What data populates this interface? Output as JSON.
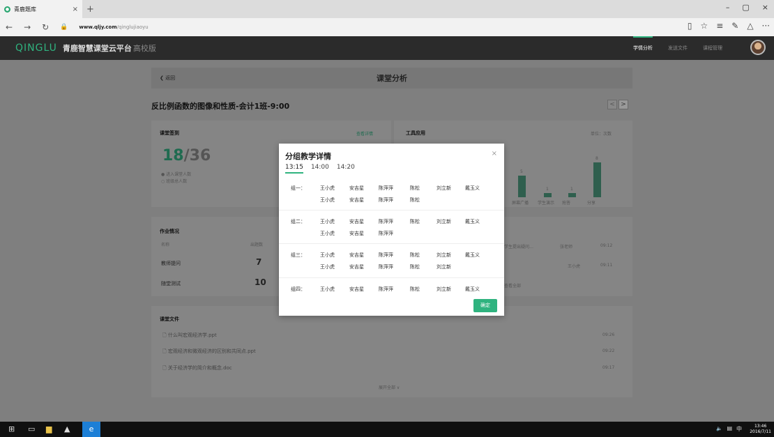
{
  "browser": {
    "tab_title": "青鹿题库",
    "tab_close": "×",
    "new_tab": "+",
    "url_domain": "www.qljy.com",
    "url_path": "/qinglujiaoyu",
    "win_min": "–",
    "win_max": "▢",
    "win_close": "×",
    "back": "←",
    "forward": "→",
    "refresh": "↻",
    "lock": "🔒",
    "reading": "▯",
    "fav": "☆",
    "hub": "≡",
    "note": "✎",
    "share": "△",
    "more": "···"
  },
  "app": {
    "logo": "QINGLU",
    "title": "青鹿智慧课堂云平台",
    "edition": "高校版",
    "nav": [
      "学情分析",
      "发送文件",
      "课程管理"
    ]
  },
  "page": {
    "back": "返回",
    "header": "课堂分析",
    "lesson": "反比例函数的图像和性质-会计1班-9:00",
    "prev": "<",
    "next": ">"
  },
  "signin": {
    "title": "课堂签到",
    "link": "查看详情",
    "count": "18",
    "total": "/36",
    "legend1": "进入课堂人数",
    "legend2": "班级总人数"
  },
  "tools": {
    "title": "工具应用",
    "unit": "单位：次数",
    "bars": [
      {
        "label": "屏幕广播",
        "value": 5
      },
      {
        "label": "学生演示",
        "value": 1
      },
      {
        "label": "抢答",
        "value": 1
      },
      {
        "label": "分享",
        "value": 8
      }
    ]
  },
  "homework": {
    "title": "作业情况",
    "col_name": "名称",
    "col_count": "出题数",
    "rows": [
      {
        "name": "教师提问",
        "count": "7"
      },
      {
        "name": "随堂测试",
        "count": "10"
      }
    ],
    "side": [
      {
        "text": "学生提出疑问…",
        "who": "张老师",
        "time": "09:12"
      },
      {
        "text": "",
        "who": "王小虎",
        "time": "09:11"
      }
    ],
    "more": "查看全部"
  },
  "files": {
    "title": "课堂文件",
    "items": [
      {
        "name": "什么叫宏观经济学.ppt",
        "time": "09:26"
      },
      {
        "name": "宏观经济和微观经济的区别和共同点.ppt",
        "time": "09:22"
      },
      {
        "name": "关于经济学的简介和概念.doc",
        "time": "09:17"
      }
    ],
    "expand": "展开全部 ∨"
  },
  "modal": {
    "title": "分组教学详情",
    "close": "×",
    "times": [
      "13:15",
      "14:00",
      "14:20"
    ],
    "groups": [
      {
        "name": "组一：",
        "rows": [
          [
            "王小虎",
            "安吉星",
            "陈萍萍",
            "陈松",
            "刘立新",
            "戴玉义"
          ],
          [
            "王小虎",
            "安吉星",
            "陈萍萍",
            "陈松"
          ]
        ]
      },
      {
        "name": "组二：",
        "rows": [
          [
            "王小虎",
            "安吉星",
            "陈萍萍",
            "陈松",
            "刘立新",
            "戴玉义"
          ],
          [
            "王小虎",
            "安吉星",
            "陈萍萍"
          ]
        ]
      },
      {
        "name": "组三：",
        "rows": [
          [
            "王小虎",
            "安吉星",
            "陈萍萍",
            "陈松",
            "刘立新",
            "戴玉义"
          ],
          [
            "王小虎",
            "安吉星",
            "陈萍萍",
            "陈松",
            "刘立新"
          ]
        ]
      },
      {
        "name": "组四：",
        "rows": [
          [
            "王小虎",
            "安吉星",
            "陈萍萍",
            "陈松",
            "刘立新",
            "戴玉义"
          ]
        ]
      }
    ],
    "confirm": "确定"
  },
  "taskbar": {
    "time": "13:46",
    "date": "2016/7/11",
    "ime": "中"
  },
  "colors": {
    "accent": "#2fb37f",
    "header": "#2b2b2b"
  }
}
